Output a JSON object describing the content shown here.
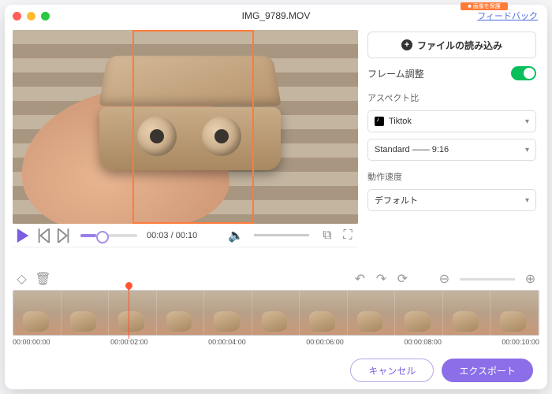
{
  "titlebar": {
    "filename": "IMG_9789.MOV",
    "feedback": "フィードバック",
    "stub": "■ 画像を保護"
  },
  "import_button": "ファイルの読み込み",
  "frame_adjust": {
    "label": "フレーム調整",
    "on": true
  },
  "aspect": {
    "label": "アスペクト比",
    "platform": "Tiktok",
    "ratio": "Standard —— 9:16"
  },
  "speed": {
    "label": "動作速度",
    "value": "デフォルト"
  },
  "playback": {
    "current": "00:03",
    "total": "00:10"
  },
  "timecodes": [
    "00:00:00:00",
    "00:00:02:00",
    "00:00:04:00",
    "00:00:06:00",
    "00:00:08:00",
    "00:00:10:00"
  ],
  "buttons": {
    "cancel": "キャンセル",
    "export": "エクスポート"
  }
}
